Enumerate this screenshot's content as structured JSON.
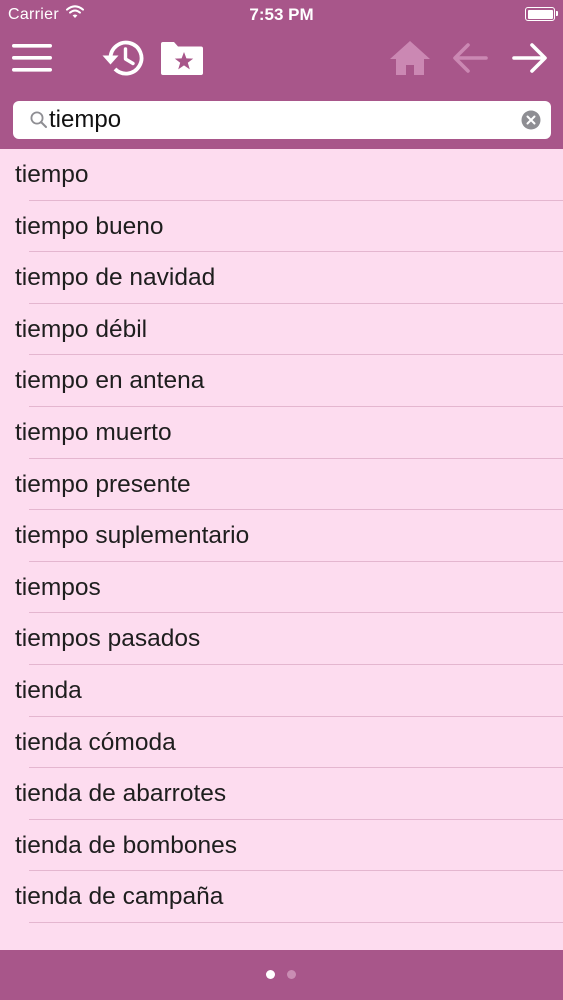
{
  "status_bar": {
    "carrier": "Carrier",
    "time": "7:53 PM",
    "icons": [
      "wifi-icon",
      "battery-icon"
    ]
  },
  "toolbar": {
    "icons": [
      "menu-icon",
      "history-icon",
      "favorites-folder-icon",
      "home-icon",
      "back-arrow-icon",
      "forward-arrow-icon"
    ],
    "enabled": {
      "menu": true,
      "history": true,
      "favorites": true,
      "home": false,
      "back": false,
      "forward": true
    }
  },
  "search": {
    "value": "tiempo",
    "icons": [
      "search-icon",
      "clear-icon"
    ]
  },
  "results": {
    "items": [
      {
        "label": "tiempo"
      },
      {
        "label": "tiempo bueno"
      },
      {
        "label": "tiempo de navidad"
      },
      {
        "label": "tiempo débil"
      },
      {
        "label": "tiempo en antena"
      },
      {
        "label": "tiempo muerto"
      },
      {
        "label": "tiempo presente"
      },
      {
        "label": "tiempo suplementario"
      },
      {
        "label": "tiempos"
      },
      {
        "label": "tiempos pasados"
      },
      {
        "label": "tienda"
      },
      {
        "label": "tienda cómoda"
      },
      {
        "label": "tienda de abarrotes"
      },
      {
        "label": "tienda de bombones"
      },
      {
        "label": "tienda de campaña"
      }
    ]
  },
  "pager": {
    "pages": 2,
    "current": 1
  },
  "colors": {
    "bar": "#a8568a",
    "list_background": "#fddcef",
    "separator": "#e4b6cf",
    "disabled_icon": "#cb88b3",
    "text": "#1e1e1e"
  }
}
